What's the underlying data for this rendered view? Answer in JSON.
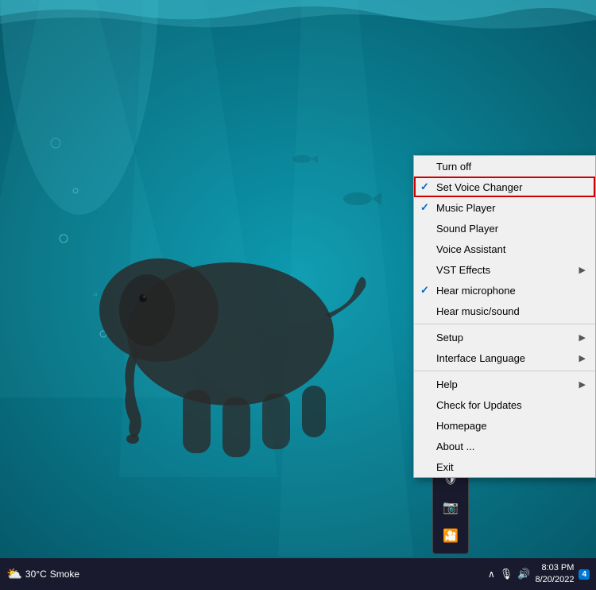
{
  "desktop": {
    "bg_color1": "#0a8a9a",
    "bg_color2": "#12b5c8"
  },
  "taskbar": {
    "weather_icon": "⛅",
    "temperature": "30°C",
    "weather_label": "Smoke",
    "time": "8:03 PM",
    "date": "8/20/2022",
    "hidden_arrow": "∧",
    "mic_icon": "🎤",
    "volume_icon": "🔊",
    "notification_count": "4"
  },
  "tray_popup": {
    "icons": [
      {
        "name": "shield-icon",
        "symbol": "🛡"
      },
      {
        "name": "camera-icon",
        "symbol": "📷"
      },
      {
        "name": "video-icon",
        "symbol": "📹"
      }
    ]
  },
  "context_menu": {
    "items": [
      {
        "id": "turn-off",
        "label": "Turn off",
        "check": false,
        "separator_after": false,
        "has_submenu": false
      },
      {
        "id": "set-voice-changer",
        "label": "Set Voice Changer",
        "check": true,
        "separator_after": false,
        "has_submenu": false,
        "highlighted": true
      },
      {
        "id": "music-player",
        "label": "Music Player",
        "check": true,
        "separator_after": false,
        "has_submenu": false
      },
      {
        "id": "sound-player",
        "label": "Sound Player",
        "check": false,
        "separator_after": false,
        "has_submenu": false
      },
      {
        "id": "voice-assistant",
        "label": "Voice Assistant",
        "check": false,
        "separator_after": false,
        "has_submenu": false
      },
      {
        "id": "vst-effects",
        "label": "VST Effects",
        "check": false,
        "separator_after": false,
        "has_submenu": true
      },
      {
        "id": "hear-microphone",
        "label": "Hear microphone",
        "check": true,
        "separator_after": false,
        "has_submenu": false
      },
      {
        "id": "hear-music-sound",
        "label": "Hear music/sound",
        "check": false,
        "separator_after": true,
        "has_submenu": false
      },
      {
        "id": "setup",
        "label": "Setup",
        "check": false,
        "separator_after": false,
        "has_submenu": true
      },
      {
        "id": "interface-language",
        "label": "Interface Language",
        "check": false,
        "separator_after": true,
        "has_submenu": true
      },
      {
        "id": "help",
        "label": "Help",
        "check": false,
        "separator_after": false,
        "has_submenu": true
      },
      {
        "id": "check-for-updates",
        "label": "Check for Updates",
        "check": false,
        "separator_after": false,
        "has_submenu": false
      },
      {
        "id": "homepage",
        "label": "Homepage",
        "check": false,
        "separator_after": false,
        "has_submenu": false
      },
      {
        "id": "about",
        "label": "About ...",
        "check": false,
        "separator_after": false,
        "has_submenu": false
      },
      {
        "id": "exit",
        "label": "Exit",
        "check": false,
        "separator_after": false,
        "has_submenu": false
      }
    ]
  }
}
